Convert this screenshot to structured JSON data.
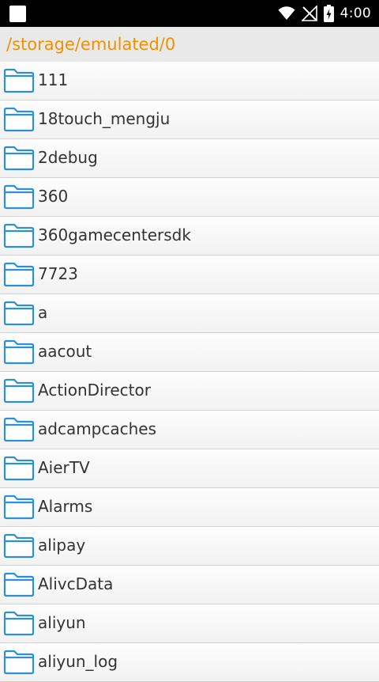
{
  "status_bar": {
    "time": "4:00"
  },
  "path": "/storage/emulated/0",
  "accent_color": "#f29100",
  "folder_icon_color": "#2f8fd6",
  "files": [
    {
      "name": "111",
      "icon": "folder-icon"
    },
    {
      "name": "18touch_mengju",
      "icon": "folder-icon"
    },
    {
      "name": "2debug",
      "icon": "folder-icon"
    },
    {
      "name": "360",
      "icon": "folder-icon"
    },
    {
      "name": "360gamecentersdk",
      "icon": "folder-icon"
    },
    {
      "name": "7723",
      "icon": "folder-icon"
    },
    {
      "name": "a",
      "icon": "folder-icon"
    },
    {
      "name": "aacout",
      "icon": "folder-icon"
    },
    {
      "name": "ActionDirector",
      "icon": "folder-icon"
    },
    {
      "name": "adcampcaches",
      "icon": "folder-icon"
    },
    {
      "name": "AierTV",
      "icon": "folder-icon"
    },
    {
      "name": "Alarms",
      "icon": "folder-icon"
    },
    {
      "name": "alipay",
      "icon": "folder-icon"
    },
    {
      "name": "AlivcData",
      "icon": "folder-icon"
    },
    {
      "name": "aliyun",
      "icon": "folder-icon"
    },
    {
      "name": "aliyun_log",
      "icon": "folder-icon"
    }
  ]
}
